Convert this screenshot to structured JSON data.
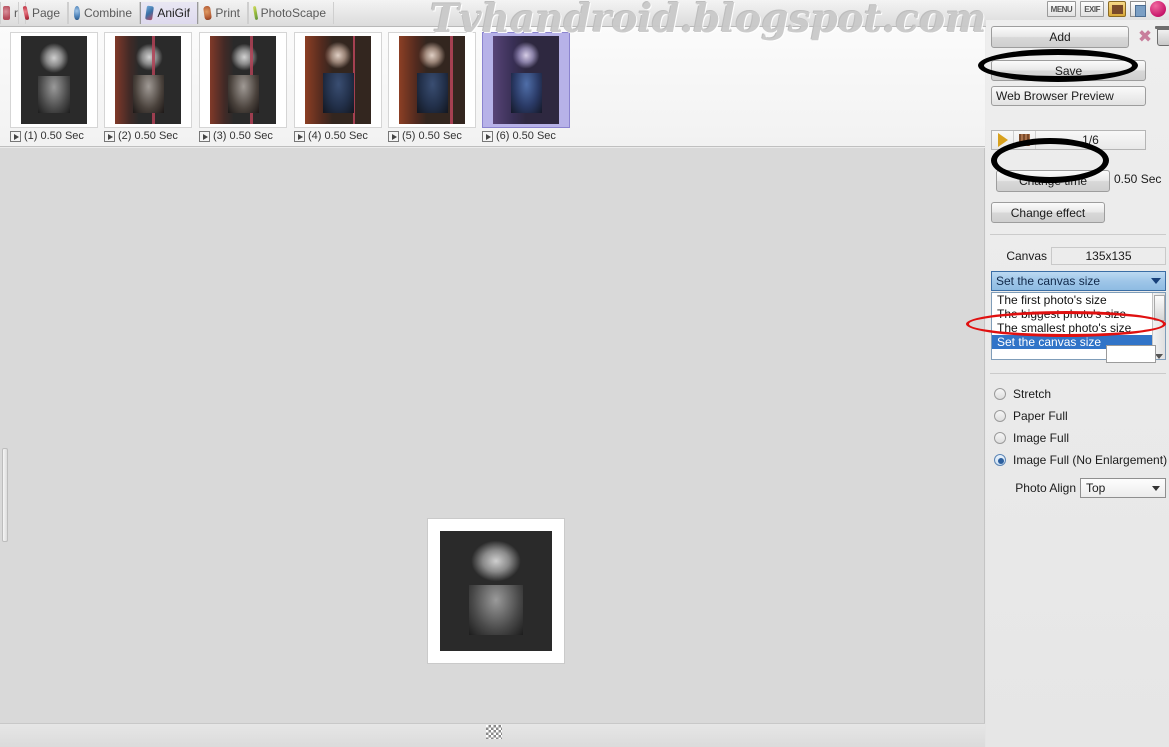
{
  "app": {
    "watermark": "Tvhandroid.blogspot.com"
  },
  "tabbar": {
    "partial_tab_label": "r",
    "tabs": [
      {
        "label": "Page",
        "icon": "page-icon",
        "active": false
      },
      {
        "label": "Combine",
        "icon": "combine-icon",
        "active": false
      },
      {
        "label": "AniGif",
        "icon": "anigif-icon",
        "active": true
      },
      {
        "label": "Print",
        "icon": "print-icon",
        "active": false
      },
      {
        "label": "PhotoScape",
        "icon": "photoscape-icon",
        "active": false
      }
    ],
    "top_icons": [
      {
        "name": "menu-icon",
        "label": "MENU"
      },
      {
        "name": "exif-icon",
        "label": "EXIF"
      },
      {
        "name": "slideshow-icon",
        "label": ""
      },
      {
        "name": "copy-icon",
        "label": ""
      },
      {
        "name": "help-icon",
        "label": ""
      }
    ]
  },
  "filmstrip": {
    "frames": [
      {
        "index": "(1)",
        "duration": "0.50 Sec",
        "label": "(1) 0.50 Sec",
        "selected": false
      },
      {
        "index": "(2)",
        "duration": "0.50 Sec",
        "label": "(2) 0.50 Sec",
        "selected": false
      },
      {
        "index": "(3)",
        "duration": "0.50 Sec",
        "label": "(3) 0.50 Sec",
        "selected": false
      },
      {
        "index": "(4)",
        "duration": "0.50 Sec",
        "label": "(4) 0.50 Sec",
        "selected": false
      },
      {
        "index": "(5)",
        "duration": "0.50 Sec",
        "label": "(5) 0.50 Sec",
        "selected": false
      },
      {
        "index": "(6)",
        "duration": "0.50 Sec",
        "label": "(6) 0.50 Sec",
        "selected": true
      }
    ]
  },
  "rightpanel": {
    "add_label": "Add",
    "save_label": "Save",
    "preview_label": "Web Browser Preview",
    "frame_counter": "1/6",
    "change_time_label": "Change time",
    "duration_value": "0.50 Sec",
    "change_effect_label": "Change effect",
    "canvas_label": "Canvas",
    "canvas_size": "135x135",
    "canvas_mode_selected": "Set the canvas size",
    "canvas_mode_options": [
      "The first photo's size",
      "The biggest photo's size",
      "The smallest photo's size",
      "Set the canvas size"
    ],
    "fit_options": [
      {
        "label": "Stretch",
        "selected": false
      },
      {
        "label": "Paper Full",
        "selected": false
      },
      {
        "label": "Image Full",
        "selected": false
      },
      {
        "label": "Image Full (No Enlargement)",
        "selected": true
      }
    ],
    "photo_align_label": "Photo Align",
    "photo_align_value": "Top"
  },
  "colors": {
    "accent_blue": "#3174c8",
    "annotation_red": "#e01010",
    "annotation_black": "#000000",
    "selection_purple": "#b7b2e8"
  }
}
